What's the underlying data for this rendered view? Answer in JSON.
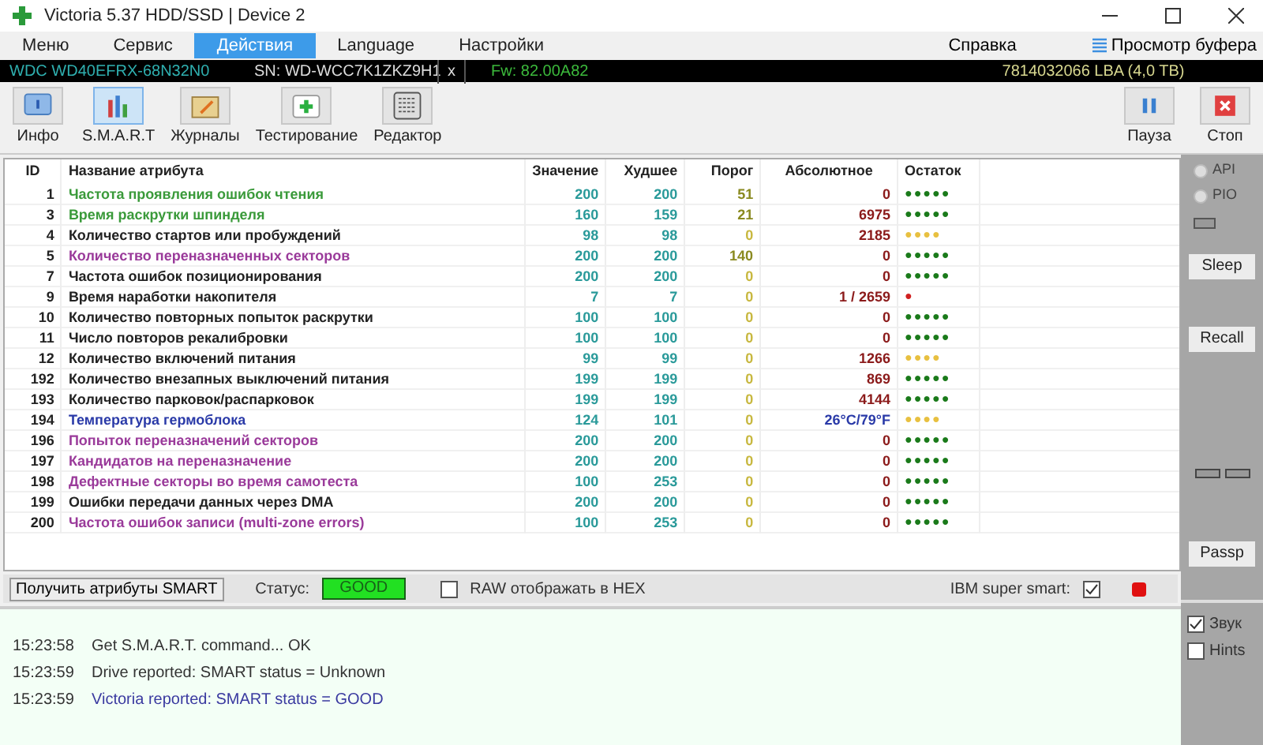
{
  "window": {
    "title": "Victoria 5.37 HDD/SSD | Device 2"
  },
  "menu": [
    {
      "label": "Меню",
      "selected": false
    },
    {
      "label": "Сервис",
      "selected": false
    },
    {
      "label": "Действия",
      "selected": true
    },
    {
      "label": "Language",
      "selected": false
    },
    {
      "label": "Настройки",
      "selected": false
    }
  ],
  "menu_right": {
    "help": "Справка",
    "buffer": "Просмотр буфера"
  },
  "drive_bar": {
    "model": "WDC WD40EFRX-68N32N0",
    "serial": "SN: WD-WCC7K1ZKZ9H1",
    "close": "x",
    "firmware": "Fw: 82.00A82",
    "capacity": "7814032066 LBA (4,0 TB)"
  },
  "toolbar": [
    {
      "label": "Инфо",
      "kind": "info",
      "selected": false
    },
    {
      "label": "S.M.A.R.T",
      "kind": "smart",
      "selected": true
    },
    {
      "label": "Журналы",
      "kind": "logs",
      "selected": false
    },
    {
      "label": "Тестирование",
      "kind": "test",
      "selected": false
    },
    {
      "label": "Редактор",
      "kind": "editor",
      "selected": false
    }
  ],
  "toolbar_right": [
    {
      "label": "Пауза",
      "kind": "pause"
    },
    {
      "label": "Стоп",
      "kind": "stop"
    }
  ],
  "table": {
    "columns": [
      "ID",
      "Название атрибута",
      "Значение",
      "Худшее",
      "Порог",
      "Абсолютное",
      "Остаток"
    ],
    "rows": [
      {
        "id": "1",
        "name": "Частота проявления ошибок чтения",
        "color": "#3a9a3a",
        "value": "200",
        "worst": "200",
        "threshold": "51",
        "raw": "0",
        "kind": "counter",
        "remaining": {
          "text": "●●●●●",
          "color": "#1a7a1a"
        }
      },
      {
        "id": "3",
        "name": "Время раскрутки шпинделя",
        "color": "#3a9a3a",
        "value": "160",
        "worst": "159",
        "threshold": "21",
        "raw": "6975",
        "kind": "counter",
        "remaining": {
          "text": "●●●●●",
          "color": "#1a7a1a"
        }
      },
      {
        "id": "4",
        "name": "Количество стартов или пробуждений",
        "color": "#222222",
        "value": "98",
        "worst": "98",
        "threshold": "0",
        "raw": "2185",
        "kind": "counter",
        "remaining": {
          "text": "●●●●",
          "color": "#e8c040"
        }
      },
      {
        "id": "5",
        "name": "Количество переназначенных секторов",
        "color": "#9a3a9a",
        "value": "200",
        "worst": "200",
        "threshold": "140",
        "raw": "0",
        "kind": "counter",
        "remaining": {
          "text": "●●●●●",
          "color": "#1a7a1a"
        }
      },
      {
        "id": "7",
        "name": "Частота ошибок позиционирования",
        "color": "#222222",
        "value": "200",
        "worst": "200",
        "threshold": "0",
        "raw": "0",
        "kind": "counter",
        "remaining": {
          "text": "●●●●●",
          "color": "#1a7a1a"
        }
      },
      {
        "id": "9",
        "name": "Время наработки накопителя",
        "color": "#222222",
        "value": "7",
        "worst": "7",
        "threshold": "0",
        "raw": "1 / 2659",
        "kind": "counter",
        "remaining": {
          "text": "●",
          "color": "#d02020"
        }
      },
      {
        "id": "10",
        "name": "Количество повторных попыток раскрутки",
        "color": "#222222",
        "value": "100",
        "worst": "100",
        "threshold": "0",
        "raw": "0",
        "kind": "counter",
        "remaining": {
          "text": "●●●●●",
          "color": "#1a7a1a"
        }
      },
      {
        "id": "11",
        "name": "Число повторов рекалибровки",
        "color": "#222222",
        "value": "100",
        "worst": "100",
        "threshold": "0",
        "raw": "0",
        "kind": "counter",
        "remaining": {
          "text": "●●●●●",
          "color": "#1a7a1a"
        }
      },
      {
        "id": "12",
        "name": "Количество включений питания",
        "color": "#222222",
        "value": "99",
        "worst": "99",
        "threshold": "0",
        "raw": "1266",
        "kind": "counter",
        "remaining": {
          "text": "●●●●",
          "color": "#e8c040"
        }
      },
      {
        "id": "192",
        "name": "Количество внезапных выключений питания",
        "color": "#222222",
        "value": "199",
        "worst": "199",
        "threshold": "0",
        "raw": "869",
        "kind": "counter",
        "remaining": {
          "text": "●●●●●",
          "color": "#1a7a1a"
        }
      },
      {
        "id": "193",
        "name": "Количество парковок/распарковок",
        "color": "#222222",
        "value": "199",
        "worst": "199",
        "threshold": "0",
        "raw": "4144",
        "kind": "counter",
        "remaining": {
          "text": "●●●●●",
          "color": "#1a7a1a"
        }
      },
      {
        "id": "194",
        "name": "Температура гермоблока",
        "color": "#2a3aa8",
        "value": "124",
        "worst": "101",
        "threshold": "0",
        "raw": "26°C/79°F",
        "kind": "temperature",
        "remaining": {
          "text": "●●●●",
          "color": "#e8c040"
        }
      },
      {
        "id": "196",
        "name": "Попыток переназначений секторов",
        "color": "#9a3a9a",
        "value": "200",
        "worst": "200",
        "threshold": "0",
        "raw": "0",
        "kind": "counter",
        "remaining": {
          "text": "●●●●●",
          "color": "#1a7a1a"
        }
      },
      {
        "id": "197",
        "name": "Кандидатов на переназначение",
        "color": "#9a3a9a",
        "value": "200",
        "worst": "200",
        "threshold": "0",
        "raw": "0",
        "kind": "counter",
        "remaining": {
          "text": "●●●●●",
          "color": "#1a7a1a"
        }
      },
      {
        "id": "198",
        "name": "Дефектные секторы во время самотеста",
        "color": "#9a3a9a",
        "value": "100",
        "worst": "253",
        "threshold": "0",
        "raw": "0",
        "kind": "counter",
        "remaining": {
          "text": "●●●●●",
          "color": "#1a7a1a"
        }
      },
      {
        "id": "199",
        "name": "Ошибки передачи данных через DMA",
        "color": "#222222",
        "value": "200",
        "worst": "200",
        "threshold": "0",
        "raw": "0",
        "kind": "counter",
        "remaining": {
          "text": "●●●●●",
          "color": "#1a7a1a"
        }
      },
      {
        "id": "200",
        "name": "Частота ошибок записи (multi-zone errors)",
        "color": "#9a3a9a",
        "value": "100",
        "worst": "253",
        "threshold": "0",
        "raw": "0",
        "kind": "counter",
        "remaining": {
          "text": "●●●●●",
          "color": "#1a7a1a"
        }
      }
    ]
  },
  "smart_bar": {
    "get_button": "Получить атрибуты SMART",
    "status_label": "Статус:",
    "status": "GOOD",
    "hex_label": "RAW отображать в HEX",
    "hex_checked": false,
    "ibm_label": "IBM super smart:",
    "ibm_checked": true
  },
  "side_panel": {
    "radios": [
      {
        "label": "API",
        "selected": false
      },
      {
        "label": "PIO",
        "selected": false
      }
    ],
    "buttons": [
      "Sleep",
      "Recall",
      "Passp"
    ]
  },
  "log": [
    {
      "time": "15:23:58",
      "text": "Get S.M.A.R.T. command... OK",
      "color": "#333333"
    },
    {
      "time": "15:23:59",
      "text": "Drive reported: SMART status = Unknown",
      "color": "#333333"
    },
    {
      "time": "15:23:59",
      "text": "Victoria reported: SMART status = GOOD",
      "color": "#3a3aa0"
    }
  ],
  "options": [
    {
      "label": "Звук",
      "checked": true
    },
    {
      "label": "Hints",
      "checked": false
    }
  ]
}
